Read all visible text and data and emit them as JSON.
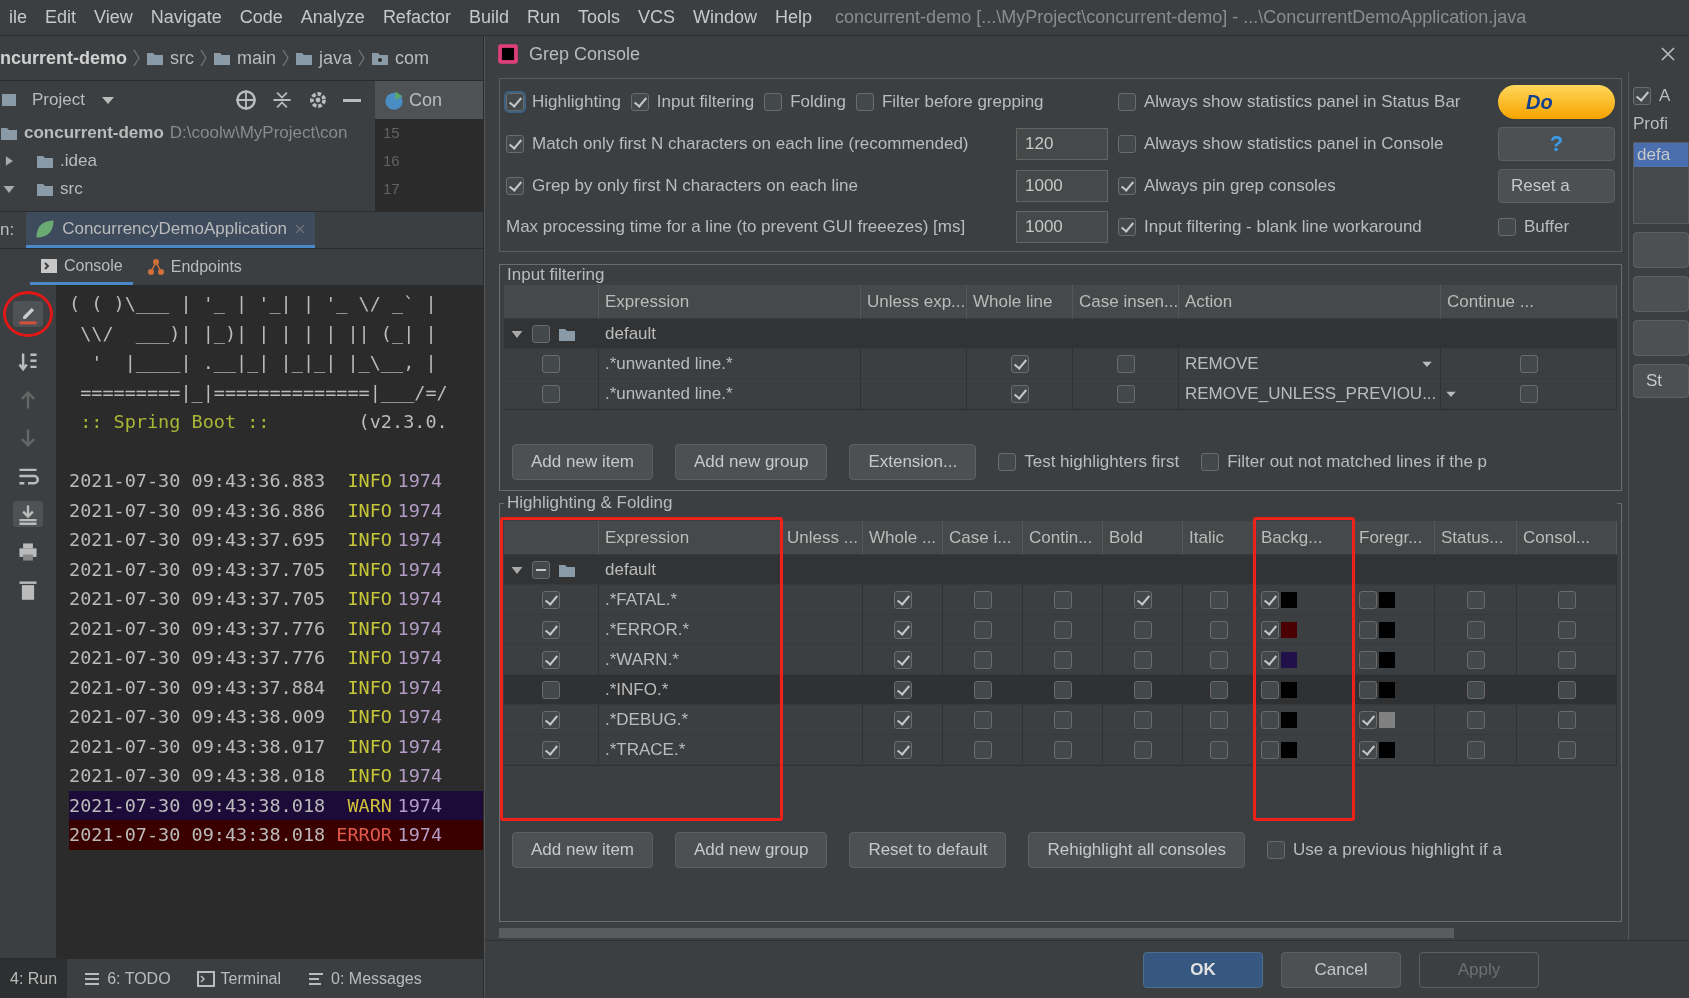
{
  "menu_bar": {
    "items": [
      "ile",
      "Edit",
      "View",
      "Navigate",
      "Code",
      "Analyze",
      "Refactor",
      "Build",
      "Run",
      "Tools",
      "VCS",
      "Window",
      "Help"
    ],
    "title": "concurrent-demo [...\\MyProject\\concurrent-demo] - ...\\ConcurrentDemoApplication.java"
  },
  "breadcrumb": [
    "ncurrent-demo",
    "src",
    "main",
    "java",
    "com"
  ],
  "project_panel": {
    "title": "Project",
    "tree": [
      {
        "label": "concurrent-demo",
        "path": "D:\\coolw\\MyProject\\con",
        "children": [
          {
            "label": ".idea",
            "expanded": false
          },
          {
            "label": "src",
            "expanded": true
          }
        ]
      }
    ]
  },
  "editor": {
    "tab": "Con",
    "line_numbers": [
      "15",
      "16",
      "17"
    ]
  },
  "run_panel": {
    "label": "n:",
    "tab": "ConcurrencyDemoApplication",
    "subtabs": [
      {
        "label": "Console",
        "selected": true
      },
      {
        "label": "Endpoints",
        "selected": false
      }
    ],
    "banner": [
      "( ( )\\___ | '_ | '_| | '_ \\/ _` |",
      " \\\\/  ___)| |_)| | | | | || (_| |",
      "  '  |____| .__|_| |_|_| |_\\__, |",
      " =========|_|==============|___/=/"
    ],
    "spring_label": " :: Spring Boot :: ",
    "spring_version": "       (v2.3.0.",
    "logs": [
      {
        "timestamp": "2021-07-30 09:43:36.883",
        "level": "INFO",
        "pid": "1974",
        "kind": "info"
      },
      {
        "timestamp": "2021-07-30 09:43:36.886",
        "level": "INFO",
        "pid": "1974",
        "kind": "info"
      },
      {
        "timestamp": "2021-07-30 09:43:37.695",
        "level": "INFO",
        "pid": "1974",
        "kind": "info"
      },
      {
        "timestamp": "2021-07-30 09:43:37.705",
        "level": "INFO",
        "pid": "1974",
        "kind": "info"
      },
      {
        "timestamp": "2021-07-30 09:43:37.705",
        "level": "INFO",
        "pid": "1974",
        "kind": "info"
      },
      {
        "timestamp": "2021-07-30 09:43:37.776",
        "level": "INFO",
        "pid": "1974",
        "kind": "info"
      },
      {
        "timestamp": "2021-07-30 09:43:37.776",
        "level": "INFO",
        "pid": "1974",
        "kind": "info"
      },
      {
        "timestamp": "2021-07-30 09:43:37.884",
        "level": "INFO",
        "pid": "1974",
        "kind": "info"
      },
      {
        "timestamp": "2021-07-30 09:43:38.009",
        "level": "INFO",
        "pid": "1974",
        "kind": "info"
      },
      {
        "timestamp": "2021-07-30 09:43:38.017",
        "level": "INFO",
        "pid": "1974",
        "kind": "info"
      },
      {
        "timestamp": "2021-07-30 09:43:38.018",
        "level": "INFO",
        "pid": "1974",
        "kind": "info"
      },
      {
        "timestamp": "2021-07-30 09:43:38.018",
        "level": "WARN",
        "pid": "1974",
        "kind": "warn"
      },
      {
        "timestamp": "2021-07-30 09:43:38.018",
        "level": "ERROR",
        "pid": "1974",
        "kind": "error"
      }
    ]
  },
  "tool_window_bar": [
    {
      "label": "4: Run",
      "selected": true
    },
    {
      "label": "6: TODO",
      "selected": false
    },
    {
      "label": "Terminal",
      "selected": false
    },
    {
      "label": "0: Messages",
      "selected": false
    }
  ],
  "dialog": {
    "title": "Grep Console",
    "toggles": [
      {
        "label": "Highlighting",
        "checked": true
      },
      {
        "label": "Input filtering",
        "checked": true
      },
      {
        "label": "Folding",
        "checked": false
      },
      {
        "label": "Filter before grepping",
        "checked": false
      }
    ],
    "limits": [
      {
        "kind": "checkbox",
        "label": "Match only first N characters on each line (recommended)",
        "checked": true,
        "value": "120"
      },
      {
        "kind": "checkbox",
        "label": "Grep by only first N characters on each line",
        "checked": true,
        "value": "1000"
      },
      {
        "kind": "plain",
        "label": "Max processing time for a line (to prevent GUI freeezes) [ms]",
        "value": "1000"
      }
    ],
    "display": [
      {
        "label": "Always show statistics panel in Status Bar",
        "checked": false
      },
      {
        "label": "Always show statistics panel in Console",
        "checked": false
      },
      {
        "label": "Always pin grep consoles",
        "checked": true
      },
      {
        "label": "Input filtering - blank line workaround",
        "checked": true
      }
    ],
    "donate": "Do",
    "help": "?",
    "reset": "Reset a",
    "buffer": {
      "label": "Buffer",
      "checked": false
    },
    "input_filtering": {
      "title": "Input filtering",
      "columns": [
        "Expression",
        "Unless exp...",
        "Whole line",
        "Case insen...",
        "Action",
        "Continue ..."
      ],
      "group": {
        "label": "default",
        "expanded": true,
        "checked": false,
        "indeterminate": false,
        "items": [
          {
            "enabled": false,
            "expression": ".*unwanted line.*",
            "whole_line": true,
            "case_insensitive": false,
            "action": "REMOVE",
            "continue": false
          },
          {
            "enabled": false,
            "expression": ".*unwanted line.*",
            "whole_line": true,
            "case_insensitive": false,
            "action": "REMOVE_UNLESS_PREVIOU...",
            "continue": false
          }
        ]
      },
      "buttons": [
        "Add new item",
        "Add new group",
        "Extension..."
      ],
      "options": [
        {
          "label": "Test highlighters first",
          "checked": false
        },
        {
          "label": "Filter out not matched lines if the p",
          "checked": false
        }
      ]
    },
    "highlighting": {
      "title": "Highlighting & Folding",
      "columns": [
        "Expression",
        "Unless ...",
        "Whole ...",
        "Case i...",
        "Contin...",
        "Bold",
        "Italic",
        "Backg...",
        "Foregr...",
        "Status...",
        "Consol..."
      ],
      "group": {
        "label": "default",
        "expanded": true,
        "indeterminate": true,
        "items": [
          {
            "enabled": true,
            "expression": ".*FATAL.*",
            "whole_line": true,
            "case_insensitive": false,
            "continue": false,
            "bold": true,
            "italic": false,
            "background": {
              "checked": true,
              "color": "#000000"
            },
            "foreground": {
              "checked": false,
              "color": "#000000"
            },
            "status_bar": false,
            "console": false,
            "selected": false
          },
          {
            "enabled": true,
            "expression": ".*ERROR.*",
            "whole_line": true,
            "case_insensitive": false,
            "continue": false,
            "bold": false,
            "italic": false,
            "background": {
              "checked": true,
              "color": "#4a0000"
            },
            "foreground": {
              "checked": false,
              "color": "#000000"
            },
            "status_bar": false,
            "console": false,
            "selected": false
          },
          {
            "enabled": true,
            "expression": ".*WARN.*",
            "whole_line": true,
            "case_insensitive": false,
            "continue": false,
            "bold": false,
            "italic": false,
            "background": {
              "checked": true,
              "color": "#22104a"
            },
            "foreground": {
              "checked": false,
              "color": "#000000"
            },
            "status_bar": false,
            "console": false,
            "selected": false
          },
          {
            "enabled": false,
            "expression": ".*INFO.*",
            "whole_line": true,
            "case_insensitive": false,
            "continue": false,
            "bold": false,
            "italic": false,
            "background": {
              "checked": false,
              "color": "#000000"
            },
            "foreground": {
              "checked": false,
              "color": "#000000"
            },
            "status_bar": false,
            "console": false,
            "selected": true
          },
          {
            "enabled": true,
            "expression": ".*DEBUG.*",
            "whole_line": true,
            "case_insensitive": false,
            "continue": false,
            "bold": false,
            "italic": false,
            "background": {
              "checked": false,
              "color": "#000000"
            },
            "foreground": {
              "checked": true,
              "color": "#808080"
            },
            "status_bar": false,
            "console": false,
            "selected": false
          },
          {
            "enabled": true,
            "expression": ".*TRACE.*",
            "whole_line": true,
            "case_insensitive": false,
            "continue": false,
            "bold": false,
            "italic": false,
            "background": {
              "checked": false,
              "color": "#000000"
            },
            "foreground": {
              "checked": true,
              "color": "#000000"
            },
            "status_bar": false,
            "console": false,
            "selected": false
          }
        ]
      },
      "buttons": [
        "Add new item",
        "Add new group",
        "Reset to default",
        "Rehighlight all consoles"
      ],
      "options": [
        {
          "label": "Use a previous highlight if a",
          "checked": false
        }
      ]
    },
    "side_panel": {
      "toggle": {
        "label": "A",
        "checked": true
      },
      "label": "Profi",
      "profiles": [
        {
          "label": "defa",
          "selected": true
        }
      ],
      "button": "St"
    },
    "footer_buttons": [
      {
        "label": "OK",
        "primary": true,
        "disabled": false
      },
      {
        "label": "Cancel",
        "primary": false,
        "disabled": false
      },
      {
        "label": "Apply",
        "primary": false,
        "disabled": true
      }
    ]
  }
}
